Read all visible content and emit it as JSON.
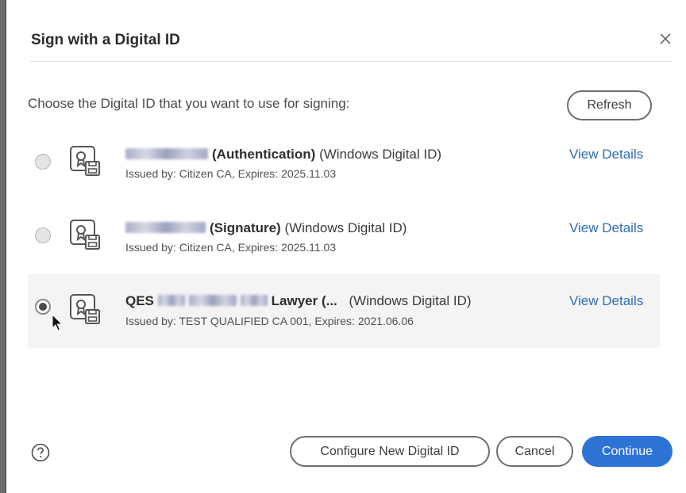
{
  "dialog": {
    "title": "Sign with a Digital ID",
    "close_icon": "close-icon",
    "prompt": "Choose the Digital ID that you want to use for signing:",
    "refresh_label": "Refresh"
  },
  "ids": [
    {
      "bold_suffix": "(Authentication)",
      "type": "(Windows Digital ID)",
      "issued": "Issued by: Citizen CA, Expires: 2025.11.03",
      "link": "View Details",
      "selected": false
    },
    {
      "bold_suffix": "(Signature)",
      "type": "(Windows Digital ID)",
      "issued": "Issued by: Citizen CA, Expires: 2025.11.03",
      "link": "View Details",
      "selected": false
    },
    {
      "bold_prefix": "QES",
      "bold_suffix": "Lawyer (...",
      "type": "(Windows Digital ID)",
      "issued": "Issued by: TEST QUALIFIED CA 001, Expires: 2021.06.06",
      "link": "View Details",
      "selected": true
    }
  ],
  "footer": {
    "help_icon": "help-icon",
    "configure_label": "Configure New Digital ID",
    "cancel_label": "Cancel",
    "continue_label": "Continue"
  },
  "colors": {
    "accent": "#2d73d4",
    "link": "#2d6db5",
    "selected_row": "#f4f4f4"
  }
}
